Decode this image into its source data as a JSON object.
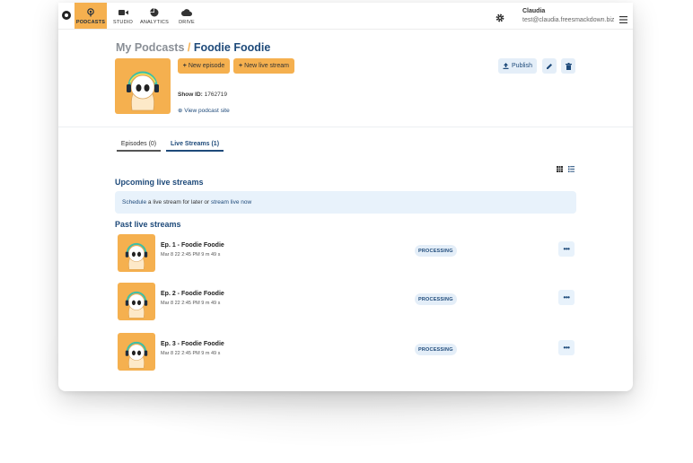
{
  "nav": {
    "items": [
      {
        "label": "PODCASTS",
        "icon": "podcast-icon",
        "active": true
      },
      {
        "label": "STUDIO",
        "icon": "camera-icon"
      },
      {
        "label": "ANALYTICS",
        "icon": "pie-chart-icon"
      },
      {
        "label": "DRIVE",
        "icon": "cloud-icon"
      }
    ]
  },
  "user": {
    "name": "Claudia",
    "email": "test@claudia.freesmackdown.biz"
  },
  "header": {
    "breadcrumb_root": "My Podcasts",
    "breadcrumb_sep": "/",
    "podcast_title": "Foodie Foodie",
    "new_episode": "New episode",
    "new_live_stream": "New live stream",
    "publish": "Publish",
    "show_id_label": "Show ID:",
    "show_id": "1762719",
    "view_site": "View podcast site"
  },
  "tabs": [
    {
      "label": "Episodes (0)"
    },
    {
      "label": "Live Streams (1)",
      "active": true
    }
  ],
  "upcoming": {
    "heading": "Upcoming live streams",
    "schedule_link": "Schedule",
    "text_middle": "a live stream for later or",
    "live_link": "stream live now"
  },
  "past": {
    "heading": "Past live streams",
    "items": [
      {
        "title": "Ep. 1 - Foodie Foodie",
        "meta": "Mar 8 22 2:45 PM  9 m 49 s",
        "status": "PROCESSING"
      },
      {
        "title": "Ep. 2 - Foodie Foodie",
        "meta": "Mar 8 22 2:45 PM  9 m 49 s",
        "status": "PROCESSING"
      },
      {
        "title": "Ep. 3 - Foodie Foodie",
        "meta": "Mar 8 22 2:45 PM  9 m 49 s",
        "status": "PROCESSING"
      }
    ]
  },
  "colors": {
    "accent": "#f5b04f",
    "primary": "#1e4a7a",
    "light": "#e8f2fb"
  }
}
